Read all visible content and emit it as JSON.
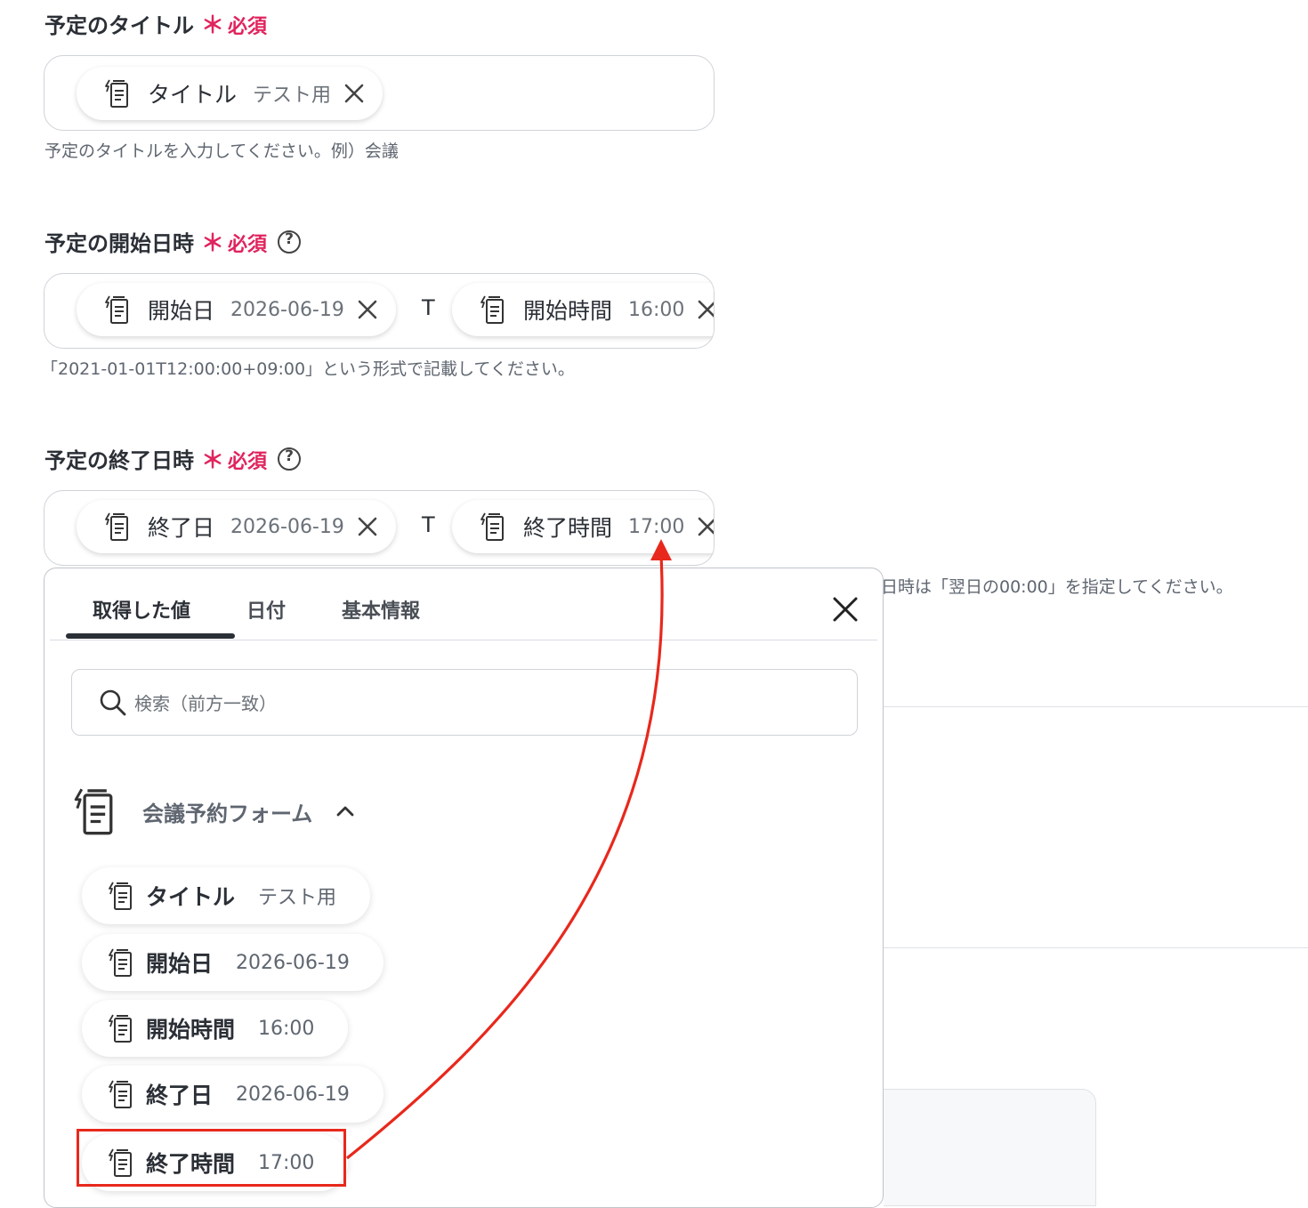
{
  "title_field": {
    "label": "予定のタイトル",
    "required": "必須",
    "required_mark": "＊",
    "pills": [
      {
        "name": "タイトル",
        "value": "テスト用"
      }
    ],
    "hint": "予定のタイトルを入力してください。例）会議"
  },
  "start_field": {
    "label": "予定の開始日時",
    "required": "必須",
    "required_mark": "＊",
    "separator": "T",
    "pills": [
      {
        "name": "開始日",
        "value": "2026-06-19"
      },
      {
        "name": "開始時間",
        "value": "16:00"
      }
    ],
    "hint": "「2021-01-01T12:00:00+09:00」という形式で記載してください。"
  },
  "end_field": {
    "label": "予定の終了日時",
    "required": "必須",
    "required_mark": "＊",
    "separator": "T",
    "pills": [
      {
        "name": "終了日",
        "value": "2026-06-19"
      },
      {
        "name": "終了時間",
        "value": "17:00"
      }
    ],
    "hint_partial": "日時は「翌日の00:00」を指定してください。"
  },
  "picker": {
    "tabs": [
      "取得した値",
      "日付",
      "基本情報"
    ],
    "active_tab": 0,
    "search_placeholder": "検索（前方一致）",
    "group_name": "会議予約フォーム",
    "items": [
      {
        "name": "タイトル",
        "value": "テスト用"
      },
      {
        "name": "開始日",
        "value": "2026-06-19"
      },
      {
        "name": "開始時間",
        "value": "16:00"
      },
      {
        "name": "終了日",
        "value": "2026-06-19"
      },
      {
        "name": "終了時間",
        "value": "17:00"
      }
    ],
    "highlighted_item": 4
  },
  "colors": {
    "required": "#e0245e",
    "annotation": "#e8281c",
    "text": "#2b2f36"
  },
  "icons": {
    "pill": "form-doc-icon",
    "remove": "close-icon",
    "help": "question-circle-icon",
    "search": "search-icon",
    "collapse": "chevron-up-icon"
  }
}
